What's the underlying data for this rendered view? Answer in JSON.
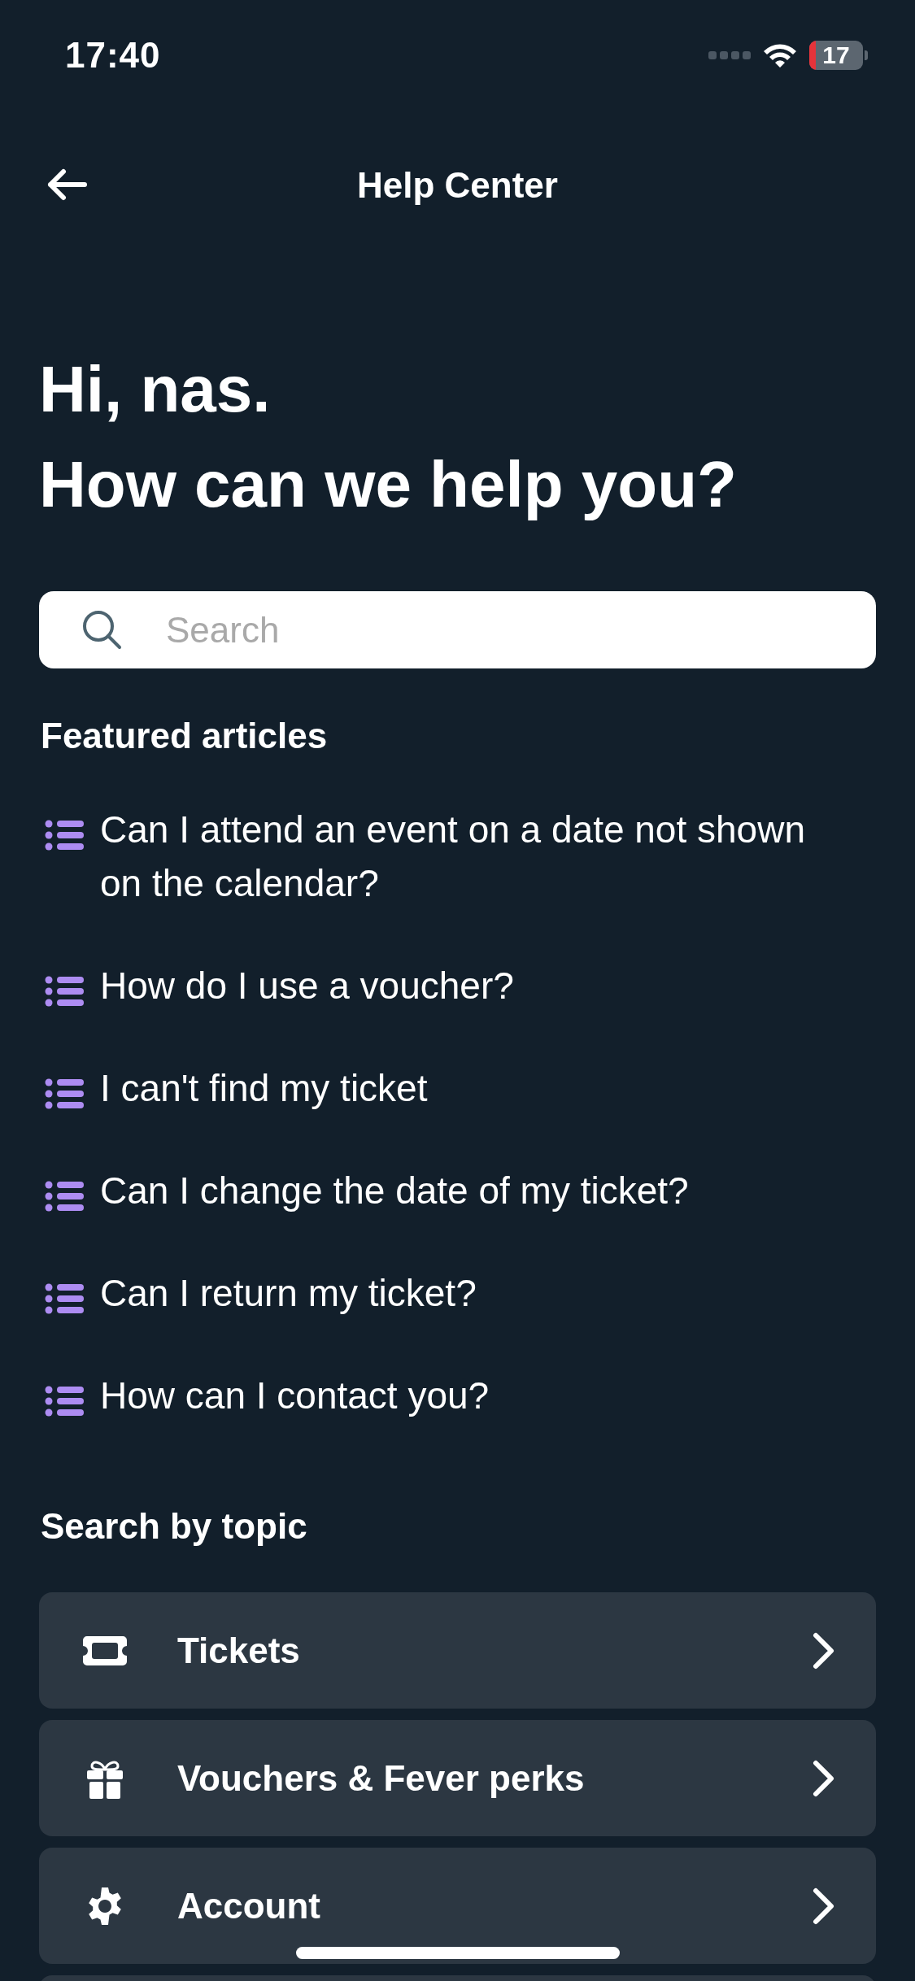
{
  "status_bar": {
    "time": "17:40",
    "battery": "17"
  },
  "header": {
    "title": "Help Center"
  },
  "greeting": {
    "line_1": "Hi, nas.",
    "line_2": "How can we help you?"
  },
  "search": {
    "placeholder": "Search"
  },
  "featured": {
    "title": "Featured articles",
    "articles": [
      {
        "title": "Can I attend an event on a date not shown on the calendar?"
      },
      {
        "title": "How do I use a voucher?"
      },
      {
        "title": "I can't find my ticket"
      },
      {
        "title": "Can I change the date of my ticket?"
      },
      {
        "title": "Can I return my ticket?"
      },
      {
        "title": "How can I contact you?"
      }
    ]
  },
  "topics": {
    "title": "Search by topic",
    "items": [
      {
        "label": "Tickets",
        "kind": "ticket"
      },
      {
        "label": "Vouchers & Fever perks",
        "kind": "gift"
      },
      {
        "label": "Account",
        "kind": "gear"
      }
    ]
  }
}
